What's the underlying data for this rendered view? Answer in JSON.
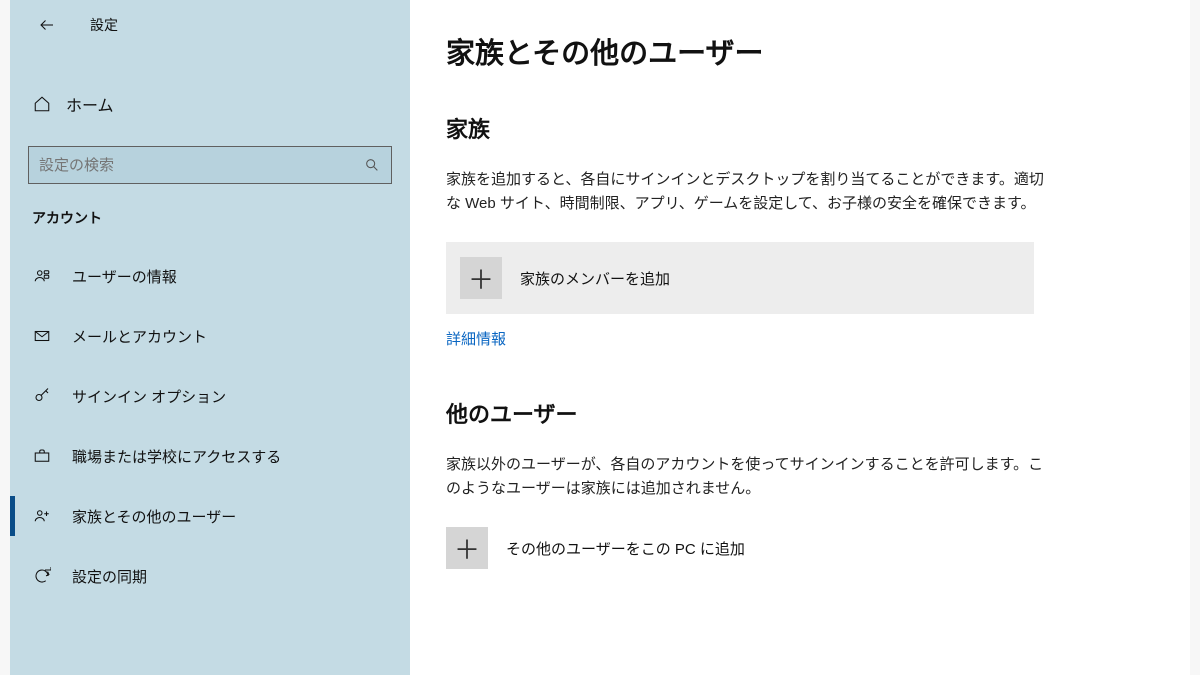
{
  "header": {
    "title": "設定"
  },
  "sidebar": {
    "home": "ホーム",
    "search_placeholder": "設定の検索",
    "section": "アカウント",
    "items": [
      {
        "label": "ユーザーの情報"
      },
      {
        "label": "メールとアカウント"
      },
      {
        "label": "サインイン オプション"
      },
      {
        "label": "職場または学校にアクセスする"
      },
      {
        "label": "家族とその他のユーザー"
      },
      {
        "label": "設定の同期"
      }
    ]
  },
  "main": {
    "title": "家族とその他のユーザー",
    "family": {
      "heading": "家族",
      "desc": "家族を追加すると、各自にサインインとデスクトップを割り当てることができます。適切な Web サイト、時間制限、アプリ、ゲームを設定して、お子様の安全を確保できます。",
      "add_label": "家族のメンバーを追加",
      "link": "詳細情報"
    },
    "others": {
      "heading": "他のユーザー",
      "desc": "家族以外のユーザーが、各自のアカウントを使ってサインインすることを許可します。このようなユーザーは家族には追加されません。",
      "add_label": "その他のユーザーをこの PC に追加"
    }
  }
}
